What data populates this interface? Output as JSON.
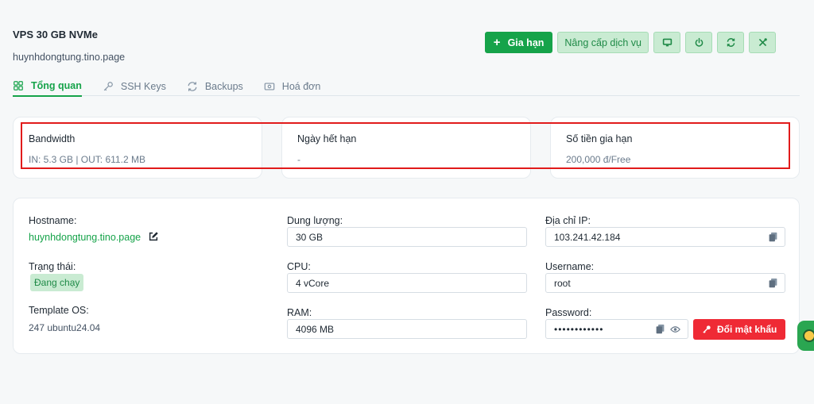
{
  "header": {
    "title": "VPS 30 GB NVMe",
    "hostname": "huynhdongtung.tino.page"
  },
  "toolbar": {
    "renew_label": "Gia hạn",
    "upgrade_label": "Nâng cấp dịch vụ",
    "icons": [
      "console-icon",
      "power-icon",
      "refresh-icon",
      "tools-icon"
    ]
  },
  "tabs": [
    {
      "label": "Tổng quan",
      "icon": "grid-icon",
      "active": true
    },
    {
      "label": "SSH Keys",
      "icon": "key-icon",
      "active": false
    },
    {
      "label": "Backups",
      "icon": "sync-icon",
      "active": false
    },
    {
      "label": "Hoá đơn",
      "icon": "invoice-icon",
      "active": false
    }
  ],
  "stats": [
    {
      "label": "Bandwidth",
      "value": "IN: 5.3 GB | OUT: 611.2 MB"
    },
    {
      "label": "Ngày hết hạn",
      "value": "-"
    },
    {
      "label": "Số tiền gia hạn",
      "value": "200,000 đ/Free"
    }
  ],
  "details": {
    "hostname_label": "Hostname:",
    "hostname_value": "huynhdongtung.tino.page",
    "status_label": "Trạng thái:",
    "status_value": "Đang chạy",
    "template_label": "Template OS:",
    "template_value": "247 ubuntu24.04",
    "storage_label": "Dung lượng:",
    "storage_value": "30 GB",
    "cpu_label": "CPU:",
    "cpu_value": "4 vCore",
    "ram_label": "RAM:",
    "ram_value": "4096 MB",
    "ip_label": "Địa chỉ IP:",
    "ip_value": "103.241.42.184",
    "username_label": "Username:",
    "username_value": "root",
    "password_label": "Password:",
    "password_value": "••••••••••••",
    "change_password_label": "Đổi mật khẩu"
  },
  "colors": {
    "accent": "#16a34a",
    "danger": "#ef2a35",
    "highlight": "#e11b1b"
  }
}
